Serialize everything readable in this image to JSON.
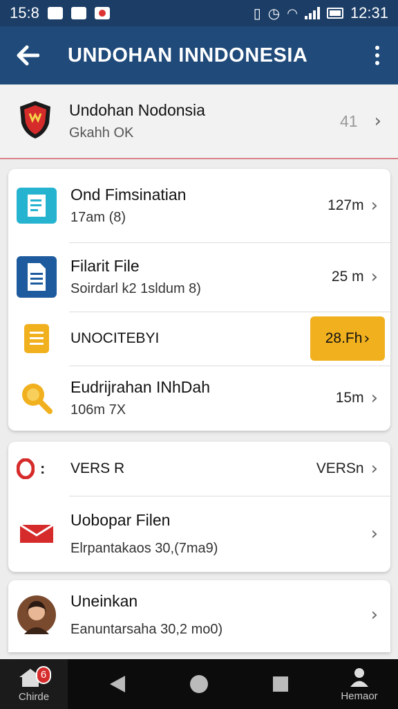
{
  "status": {
    "time_left": "15:8",
    "time_right": "12:31"
  },
  "appbar": {
    "title": "UNDOHAN INNDONESIA"
  },
  "header": {
    "title": "Undohan Nodonsia",
    "subtitle": "Gkahh OK",
    "count": "41"
  },
  "card1": [
    {
      "title": "Ond Fimsinatian",
      "subtitle": "17am (8)",
      "value": "127m",
      "icon": "document-teal-icon"
    },
    {
      "title": "Filarit File",
      "subtitle": "Soirdarl k2 1sldum 8)",
      "value": "25 m",
      "icon": "document-blue-icon"
    },
    {
      "title": "UNOCITEBYI",
      "value": "28.Fh",
      "icon": "note-yellow-icon",
      "highlighted": true
    },
    {
      "title": "Eudrijrahan INhDah",
      "subtitle": "106m 7X",
      "value": "15m",
      "icon": "search-yellow-icon"
    }
  ],
  "card2": [
    {
      "prefix": "O:",
      "title": "VERS R",
      "value": "VERSn",
      "icon": "opera-icon"
    },
    {
      "title": "Uobopar Filen",
      "subtitle": "Elrpantakaos 30,(7ma9)",
      "icon": "mail-icon"
    }
  ],
  "card3": [
    {
      "title": "Uneinkan",
      "subtitle": "Eanuntarsaha 30,2 mo0)",
      "icon": "avatar"
    }
  ],
  "navbar": {
    "left_label": "Chirde",
    "right_label": "Hemaor",
    "badge": "6"
  },
  "colors": {
    "appbar": "#1f4a7a",
    "statusbar": "#1b3d66",
    "accent": "#f1b01e",
    "divider": "#d9828a"
  }
}
